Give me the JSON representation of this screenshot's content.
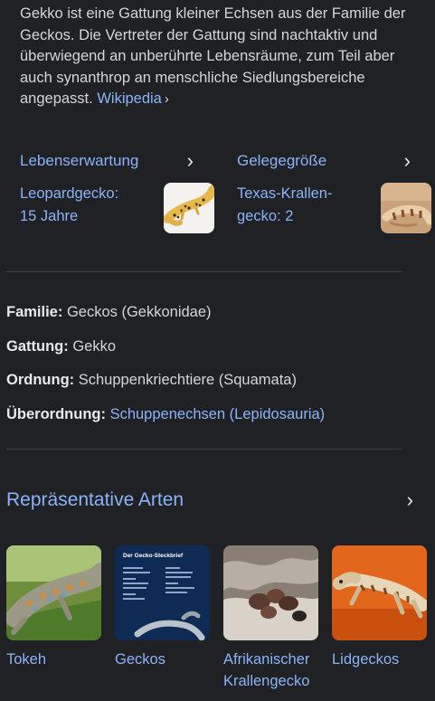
{
  "description": {
    "text": "Gekko ist eine Gattung kleiner Echsen aus der Familie der Geckos. Die Vertreter der Gattung sind nachtaktiv und überwiegend an unberührte Lebensräume, zum Teil aber auch synanthrop an menschliche Siedlungsbereiche angepasst.",
    "source_label": "Wikipedia",
    "chevron": "›"
  },
  "facts": [
    {
      "heading": "Lebenserwartung",
      "line1": "Leopardgecko:",
      "line2": "15 Jahre",
      "image_icon": "leopard-gecko-photo"
    },
    {
      "heading": "Gelegegröße",
      "line1": "Texas-Krallen-",
      "line2": "gecko: 2",
      "image_icon": "texas-banded-gecko-photo"
    }
  ],
  "attributes": [
    {
      "key": "Familie:",
      "value": "Geckos (Gekkonidae)",
      "is_link": false
    },
    {
      "key": "Gattung:",
      "value": "Gekko",
      "is_link": false
    },
    {
      "key": "Ordnung:",
      "value": "Schuppenkriechtiere (Squamata)",
      "is_link": false
    },
    {
      "key": "Überordnung:",
      "value": "Schuppenechsen (Lepidosauria)",
      "is_link": true
    }
  ],
  "representative": {
    "title": "Repräsentative Arten",
    "cards": [
      {
        "label": "Tokeh",
        "image_icon": "tokay-gecko-photo"
      },
      {
        "label": "Geckos",
        "image_icon": "gecko-factsheet-photo",
        "poster_title": "Der Gecko-Steckbrief"
      },
      {
        "label": "Afrikanischer Krallengecko",
        "image_icon": "african-clawed-gecko-photo"
      },
      {
        "label": "Lidgeckos",
        "image_icon": "eyelid-gecko-photo"
      }
    ]
  },
  "colors": {
    "background": "#202124",
    "link": "#8ab4f8",
    "text": "#d6d6d6",
    "divider": "#3c4043"
  }
}
